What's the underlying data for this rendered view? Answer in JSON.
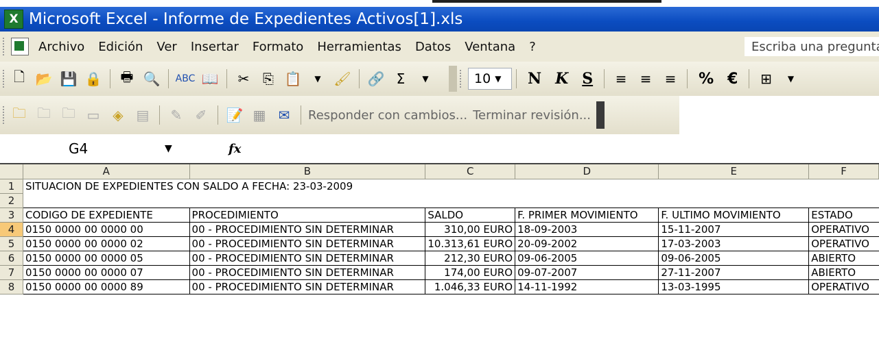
{
  "window": {
    "title": "Microsoft Excel - Informe de Expedientes Activos[1].xls"
  },
  "menu": {
    "items": [
      "Archivo",
      "Edición",
      "Ver",
      "Insertar",
      "Formato",
      "Herramientas",
      "Datos",
      "Ventana",
      "?"
    ],
    "help_placeholder": "Escriba una pregunta"
  },
  "toolbar": {
    "font_size": "10",
    "bold": "N",
    "italic": "K",
    "underline": "S",
    "percent": "%",
    "euro": "€",
    "sum": "Σ"
  },
  "review_toolbar": {
    "reply_label": "Responder con cambios...",
    "end_review_label": "Terminar revisión..."
  },
  "formula_bar": {
    "name_box": "G4",
    "fx_label": "fx",
    "formula": ""
  },
  "sheet": {
    "columns": [
      "A",
      "B",
      "C",
      "D",
      "E",
      "F"
    ],
    "rows": [
      "1",
      "2",
      "3",
      "4",
      "5",
      "6",
      "7",
      "8"
    ],
    "title_cell": "SITUACION DE EXPEDIENTES CON SALDO A FECHA: 23-03-2009",
    "headers": [
      "CODIGO DE EXPEDIENTE",
      "PROCEDIMIENTO",
      "SALDO",
      "F. PRIMER MOVIMIENTO",
      "F. ULTIMO MOVIMIENTO",
      "ESTADO"
    ],
    "data": [
      [
        "0150 0000 00 0000 00",
        "00 - PROCEDIMIENTO SIN DETERMINAR",
        "310,00 EURO",
        "18-09-2003",
        "15-11-2007",
        "OPERATIVO"
      ],
      [
        "0150 0000 00 0000 02",
        "00 - PROCEDIMIENTO SIN DETERMINAR",
        "10.313,61 EURO",
        "20-09-2002",
        "17-03-2003",
        "OPERATIVO"
      ],
      [
        "0150 0000 00 0000 05",
        "00 - PROCEDIMIENTO SIN DETERMINAR",
        "212,30 EURO",
        "09-06-2005",
        "09-06-2005",
        "ABIERTO"
      ],
      [
        "0150 0000 00 0000 07",
        "00 - PROCEDIMIENTO SIN DETERMINAR",
        "174,00 EURO",
        "09-07-2007",
        "27-11-2007",
        "ABIERTO"
      ],
      [
        "0150 0000 00 0000 89",
        "00 - PROCEDIMIENTO SIN DETERMINAR",
        "1.046,33 EURO",
        "14-11-1992",
        "13-03-1995",
        "OPERATIVO"
      ]
    ]
  },
  "colors": {
    "titlebar": "#0b4cc0",
    "chrome": "#ece9d8",
    "active_row_header": "#f7c978"
  }
}
